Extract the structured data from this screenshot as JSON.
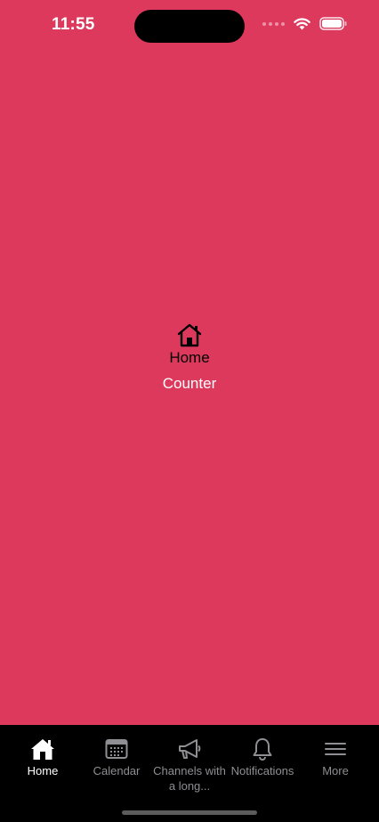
{
  "status_bar": {
    "time": "11:55"
  },
  "content": {
    "title": "Home",
    "subtitle": "Counter",
    "title_icon": "home-icon"
  },
  "tabs": [
    {
      "label": "Home",
      "icon": "home-icon",
      "active": true
    },
    {
      "label": "Calendar",
      "icon": "calendar-icon",
      "active": false
    },
    {
      "label": "Channels with a long...",
      "icon": "megaphone-icon",
      "active": false
    },
    {
      "label": "Notifications",
      "icon": "bell-icon",
      "active": false
    },
    {
      "label": "More",
      "icon": "menu-icon",
      "active": false
    }
  ],
  "colors": {
    "background": "#DD395D",
    "tabbar": "#000000",
    "active_tab": "#FFFFFF",
    "inactive_tab": "#8E8E93"
  }
}
